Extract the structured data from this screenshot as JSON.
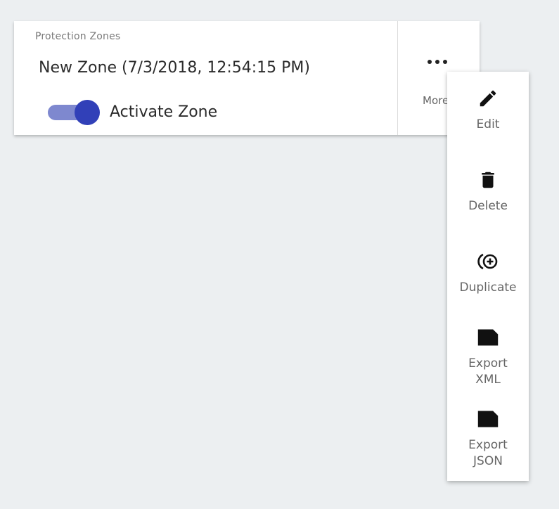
{
  "card": {
    "section_label": "Protection Zones",
    "zone_name": "New Zone (7/3/2018, 12:54:15 PM)",
    "toggle_label": "Activate Zone",
    "toggle_on": true,
    "more_label": "More"
  },
  "menu": {
    "items": [
      {
        "label": "Edit",
        "icon": "pencil-icon"
      },
      {
        "label": "Delete",
        "icon": "trash-icon"
      },
      {
        "label": "Duplicate",
        "icon": "duplicate-icon"
      },
      {
        "label": "Export XML",
        "icon": "file-icon"
      },
      {
        "label": "Export JSON",
        "icon": "file-icon"
      }
    ]
  },
  "colors": {
    "toggle_track": "#7e88cf",
    "toggle_knob": "#3140b8",
    "background": "#eceff1"
  }
}
